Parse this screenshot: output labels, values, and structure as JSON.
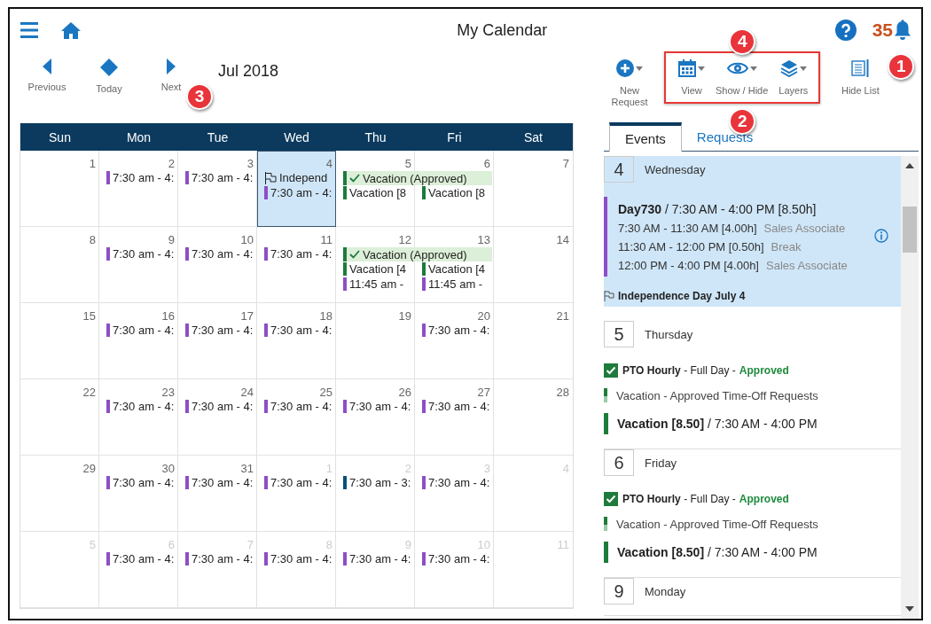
{
  "header": {
    "title": "My Calendar",
    "notification_count": "35"
  },
  "nav": {
    "buttons": [
      {
        "kind": "previous",
        "label": "Previous"
      },
      {
        "kind": "today",
        "label": "Today"
      },
      {
        "kind": "next",
        "label": "Next",
        "callout": "3"
      }
    ],
    "month": "Jul 2018"
  },
  "toolbar": {
    "new_request": {
      "label": "New Request"
    },
    "group": {
      "highlighted": true,
      "callout_above": "4",
      "callout_below": "2",
      "tools": [
        {
          "kind": "view",
          "label": "View"
        },
        {
          "kind": "show_hide",
          "label": "Show / Hide"
        },
        {
          "kind": "layers",
          "label": "Layers"
        }
      ]
    },
    "hide_list": {
      "label": "Hide List",
      "callout": "1"
    }
  },
  "calendar": {
    "weekdays": [
      "Sun",
      "Mon",
      "Tue",
      "Wed",
      "Thu",
      "Fri",
      "Sat"
    ],
    "weeks": [
      {
        "days": [
          {
            "day": "1",
            "muted": false,
            "selected": false
          },
          {
            "day": "2",
            "muted": false,
            "selected": false,
            "events": [
              {
                "kind": "bar",
                "text": "7:30 am - 4:",
                "color": "#8e4ec6"
              }
            ]
          },
          {
            "day": "3",
            "muted": false,
            "selected": false,
            "events": [
              {
                "kind": "bar",
                "text": "7:30 am - 4:",
                "color": "#8e4ec6"
              }
            ]
          },
          {
            "day": "4",
            "muted": false,
            "selected": true,
            "events": [
              {
                "kind": "holiday",
                "text": "Independ"
              },
              {
                "kind": "bar",
                "text": "7:30 am - 4:",
                "color": "#8e4ec6"
              }
            ]
          },
          {
            "day": "5",
            "muted": false,
            "selected": false,
            "events": [
              {
                "kind": "banner",
                "text": "Vacation (Approved)",
                "continues": true
              },
              {
                "kind": "bar",
                "text": "Vacation [8",
                "color": "#1e7b3c"
              }
            ]
          },
          {
            "day": "6",
            "muted": false,
            "selected": false,
            "events": [
              {
                "kind": "bar",
                "text": "Vacation [8",
                "color": "#1e7b3c"
              }
            ]
          },
          {
            "day": "7",
            "muted": false,
            "selected": false
          }
        ]
      },
      {
        "days": [
          {
            "day": "8",
            "muted": false,
            "selected": false
          },
          {
            "day": "9",
            "muted": false,
            "selected": false,
            "events": [
              {
                "kind": "bar",
                "text": "7:30 am - 4:",
                "color": "#8e4ec6"
              }
            ]
          },
          {
            "day": "10",
            "muted": false,
            "selected": false,
            "events": [
              {
                "kind": "bar",
                "text": "7:30 am - 4:",
                "color": "#8e4ec6"
              }
            ]
          },
          {
            "day": "11",
            "muted": false,
            "selected": false,
            "events": [
              {
                "kind": "bar",
                "text": "7:30 am - 4:",
                "color": "#8e4ec6"
              }
            ]
          },
          {
            "day": "12",
            "muted": false,
            "selected": false,
            "events": [
              {
                "kind": "banner",
                "text": "Vacation (Approved)",
                "continues": true
              },
              {
                "kind": "bar",
                "text": "Vacation [4",
                "color": "#1e7b3c"
              },
              {
                "kind": "bar",
                "text": "11:45 am -",
                "color": "#8e4ec6"
              }
            ]
          },
          {
            "day": "13",
            "muted": false,
            "selected": false,
            "events": [
              {
                "kind": "bar",
                "text": "Vacation [4",
                "color": "#1e7b3c"
              },
              {
                "kind": "bar",
                "text": "11:45 am -",
                "color": "#8e4ec6"
              }
            ]
          },
          {
            "day": "14",
            "muted": false,
            "selected": false
          }
        ]
      },
      {
        "days": [
          {
            "day": "15",
            "muted": false,
            "selected": false
          },
          {
            "day": "16",
            "muted": false,
            "selected": false,
            "events": [
              {
                "kind": "bar",
                "text": "7:30 am - 4:",
                "color": "#8e4ec6"
              }
            ]
          },
          {
            "day": "17",
            "muted": false,
            "selected": false,
            "events": [
              {
                "kind": "bar",
                "text": "7:30 am - 4:",
                "color": "#8e4ec6"
              }
            ]
          },
          {
            "day": "18",
            "muted": false,
            "selected": false,
            "events": [
              {
                "kind": "bar",
                "text": "7:30 am - 4:",
                "color": "#8e4ec6"
              }
            ]
          },
          {
            "day": "19",
            "muted": false,
            "selected": false
          },
          {
            "day": "20",
            "muted": false,
            "selected": false,
            "events": [
              {
                "kind": "bar",
                "text": "7:30 am - 4:",
                "color": "#8e4ec6"
              }
            ]
          },
          {
            "day": "21",
            "muted": false,
            "selected": false
          }
        ]
      },
      {
        "days": [
          {
            "day": "22",
            "muted": false,
            "selected": false
          },
          {
            "day": "23",
            "muted": false,
            "selected": false,
            "events": [
              {
                "kind": "bar",
                "text": "7:30 am - 4:",
                "color": "#8e4ec6"
              }
            ]
          },
          {
            "day": "24",
            "muted": false,
            "selected": false,
            "events": [
              {
                "kind": "bar",
                "text": "7:30 am - 4:",
                "color": "#8e4ec6"
              }
            ]
          },
          {
            "day": "25",
            "muted": false,
            "selected": false,
            "events": [
              {
                "kind": "bar",
                "text": "7:30 am - 4:",
                "color": "#8e4ec6"
              }
            ]
          },
          {
            "day": "26",
            "muted": false,
            "selected": false,
            "events": [
              {
                "kind": "bar",
                "text": "7:30 am - 4:",
                "color": "#8e4ec6"
              }
            ]
          },
          {
            "day": "27",
            "muted": false,
            "selected": false,
            "events": [
              {
                "kind": "bar",
                "text": "7:30 am - 4:",
                "color": "#8e4ec6"
              }
            ]
          },
          {
            "day": "28",
            "muted": false,
            "selected": false
          }
        ]
      },
      {
        "days": [
          {
            "day": "29",
            "muted": false,
            "selected": false
          },
          {
            "day": "30",
            "muted": false,
            "selected": false,
            "events": [
              {
                "kind": "bar",
                "text": "7:30 am - 4:",
                "color": "#8e4ec6"
              }
            ]
          },
          {
            "day": "31",
            "muted": false,
            "selected": false,
            "events": [
              {
                "kind": "bar",
                "text": "7:30 am - 4:",
                "color": "#8e4ec6"
              }
            ]
          },
          {
            "day": "1",
            "muted": true,
            "selected": false,
            "events": [
              {
                "kind": "bar",
                "text": "7:30 am - 4:",
                "color": "#8e4ec6"
              }
            ]
          },
          {
            "day": "2",
            "muted": true,
            "selected": false,
            "events": [
              {
                "kind": "bar",
                "text": "7:30 am - 3:",
                "color": "#0b4f7c"
              }
            ]
          },
          {
            "day": "3",
            "muted": true,
            "selected": false,
            "events": [
              {
                "kind": "bar",
                "text": "7:30 am - 4:",
                "color": "#8e4ec6"
              }
            ]
          },
          {
            "day": "4",
            "muted": true,
            "selected": false
          }
        ]
      },
      {
        "days": [
          {
            "day": "5",
            "muted": true,
            "selected": false
          },
          {
            "day": "6",
            "muted": true,
            "selected": false,
            "events": [
              {
                "kind": "bar",
                "text": "7:30 am - 4:",
                "color": "#8e4ec6"
              }
            ]
          },
          {
            "day": "7",
            "muted": true,
            "selected": false,
            "events": [
              {
                "kind": "bar",
                "text": "7:30 am - 4:",
                "color": "#8e4ec6"
              }
            ]
          },
          {
            "day": "8",
            "muted": true,
            "selected": false,
            "events": [
              {
                "kind": "bar",
                "text": "7:30 am - 4:",
                "color": "#8e4ec6"
              }
            ]
          },
          {
            "day": "9",
            "muted": true,
            "selected": false,
            "events": [
              {
                "kind": "bar",
                "text": "7:30 am - 4:",
                "color": "#8e4ec6"
              }
            ]
          },
          {
            "day": "10",
            "muted": true,
            "selected": false,
            "events": [
              {
                "kind": "bar",
                "text": "7:30 am - 4:",
                "color": "#8e4ec6"
              }
            ]
          },
          {
            "day": "11",
            "muted": true,
            "selected": false
          }
        ]
      }
    ]
  },
  "tabs": [
    {
      "label": "Events",
      "selected": true
    },
    {
      "label": "Requests",
      "selected": false
    }
  ],
  "agenda": [
    {
      "day": "4",
      "weekday": "Wednesday",
      "selected": true,
      "items": [
        {
          "kind": "shift",
          "color": "#8e4ec6",
          "title": "**Day730** / 7:30 AM - 4:00 PM [8.50h]",
          "info": true,
          "segments": [
            {
              "time": "7:30 AM - 11:30 AM [4.00h]",
              "role": "Sales Associate"
            },
            {
              "time": "11:30 AM - 12:00 PM [0.50h]",
              "role": "Break"
            },
            {
              "time": "12:00 PM - 4:00 PM [4.00h]",
              "role": "Sales Associate"
            }
          ]
        },
        {
          "kind": "holiday",
          "text": "Independence Day July 4"
        }
      ]
    },
    {
      "day": "5",
      "weekday": "Thursday",
      "selected": false,
      "items": [
        {
          "kind": "request",
          "checked": true,
          "text": "**PTO Hourly** - Full Day -",
          "status": "Approved"
        },
        {
          "kind": "layer",
          "text": "Vacation - Approved Time-Off Requests"
        },
        {
          "kind": "timeoff",
          "color": "#1e7b3c",
          "text": "**Vacation [8.50]** / 7:30 AM - 4:00 PM"
        }
      ]
    },
    {
      "day": "6",
      "weekday": "Friday",
      "selected": false,
      "items": [
        {
          "kind": "request",
          "checked": true,
          "text": "**PTO Hourly** - Full Day -",
          "status": "Approved"
        },
        {
          "kind": "layer",
          "text": "Vacation - Approved Time-Off Requests"
        },
        {
          "kind": "timeoff",
          "color": "#1e7b3c",
          "text": "**Vacation [8.50]** / 7:30 AM - 4:00 PM"
        }
      ]
    },
    {
      "day": "9",
      "weekday": "Monday",
      "selected": false
    }
  ]
}
